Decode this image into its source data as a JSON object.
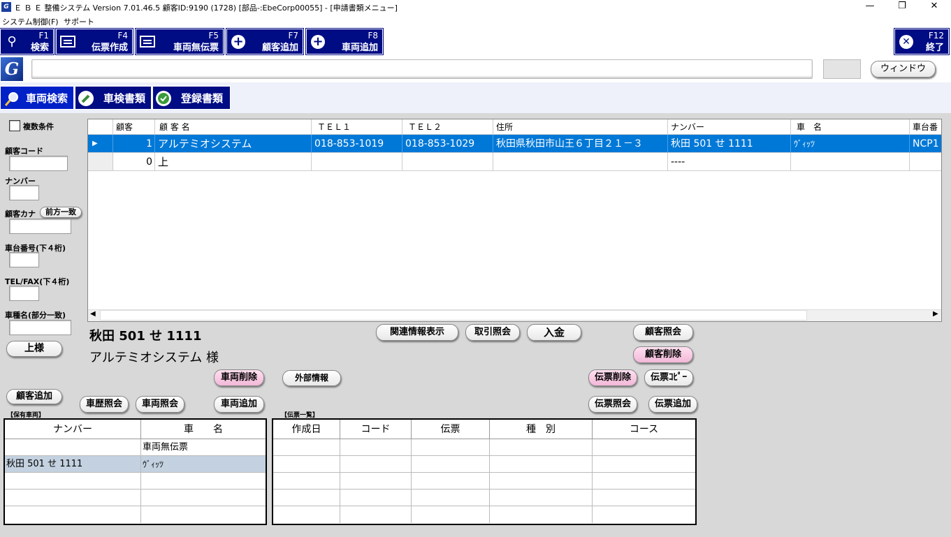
{
  "titlebar": {
    "title": "Ｅ Ｂ Ｅ 整備システム Version 7.01.46.5 顧客ID:9190  (1728) [部品-:EbeCorp00055] - [申請書類メニュー]"
  },
  "menubar": {
    "items": [
      "システム制御(F)",
      "サポート"
    ]
  },
  "toolbar": {
    "keys": [
      {
        "key": "F1",
        "label": "検索"
      },
      {
        "key": "F4",
        "label": "伝票作成"
      },
      {
        "key": "F5",
        "label": "車両無伝票"
      },
      {
        "key": "F7",
        "label": "顧客追加"
      },
      {
        "key": "F8",
        "label": "車両追加"
      },
      {
        "key": "F12",
        "label": "終了"
      }
    ]
  },
  "command": {
    "window_label": "ウィンドウ"
  },
  "tabs": [
    "車両検索",
    "車検書類",
    "登録書類"
  ],
  "search": {
    "multi_condition": "複数条件",
    "customer_code": "顧客コード",
    "number": "ナンバー",
    "customer_kana": "顧客カナ",
    "prefix_match": "前方一致",
    "chassis_no": "車台番号(下４桁)",
    "tel_fax": "TEL/FAX(下４桁)",
    "car_type": "車種名(部分一致)",
    "honorific_btn": "上様"
  },
  "grid": {
    "headers": [
      "顧客",
      "顧 客 名",
      "ＴＥＬ１",
      "ＴＥＬ２",
      "住所",
      "ナンバー",
      "車　名",
      "車台番"
    ],
    "rows": [
      [
        "1",
        "アルテミオシステム",
        "018-853-1019",
        "018-853-1029",
        "秋田県秋田市山王６丁目２１－３",
        "秋田 501 せ 1111",
        "ｳﾞｨｯﾂ",
        "NCP1"
      ],
      [
        "0",
        "上",
        "",
        "",
        "",
        "----",
        "",
        ""
      ]
    ]
  },
  "detail": {
    "plate": "秋田 501 せ 1111",
    "customer": "アルテミオシステム 様"
  },
  "buttons": {
    "related": "関連情報表示",
    "trade": "取引照会",
    "payment": "入金",
    "cust_inquiry": "顧客照会",
    "cust_delete": "顧客削除",
    "car_delete": "車両削除",
    "external": "外部情報",
    "slip_delete": "伝票削除",
    "slip_copy": "伝票ｺﾋﾟｰ",
    "cust_add": "顧客追加",
    "car_history": "車歴照会",
    "car_inquiry": "車両照会",
    "car_add": "車両追加",
    "slip_inquiry": "伝票照会",
    "slip_add": "伝票追加"
  },
  "owned": {
    "caption": "【保有車両】",
    "headers": [
      "ナンバー",
      "車　　名"
    ],
    "rows": [
      [
        "",
        "車両無伝票"
      ],
      [
        "秋田  501 せ 1111",
        "ｳﾞｨｯﾂ"
      ]
    ]
  },
  "slips": {
    "caption": "【伝票一覧】",
    "headers": [
      "作成日",
      "コード",
      "伝票",
      "種　別",
      "コース"
    ]
  },
  "colors": {
    "navy": "#000c84",
    "selection": "#0078d7",
    "row_highlight": "#c3d1e0"
  }
}
